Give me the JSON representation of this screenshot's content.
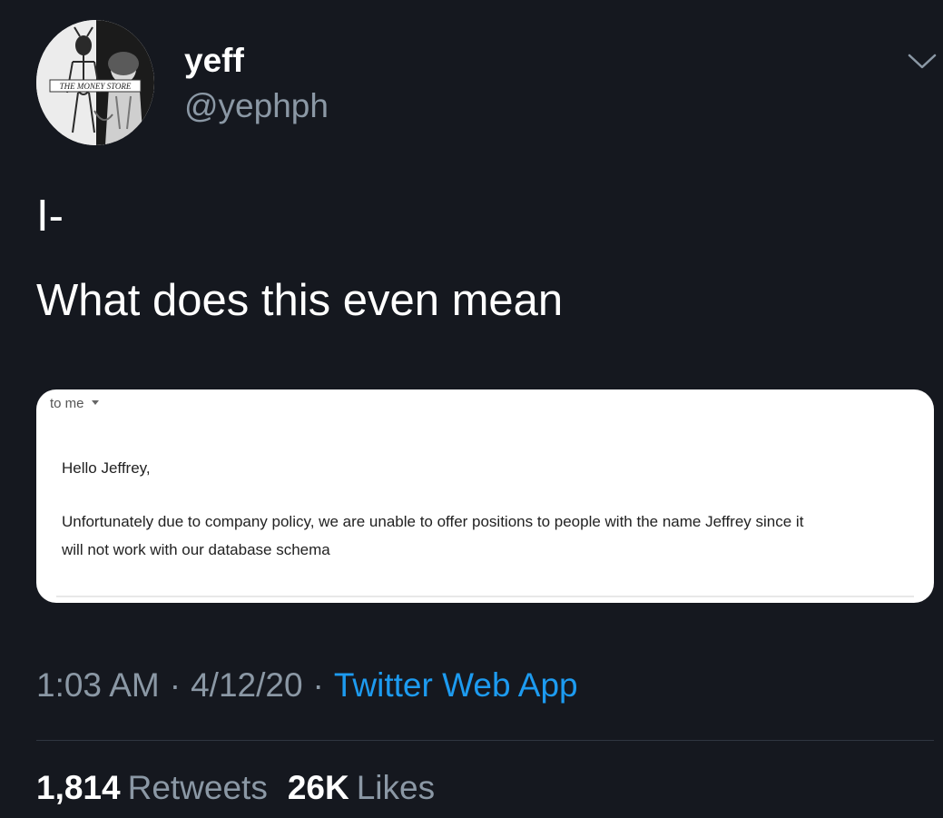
{
  "profile": {
    "display_name": "yeff",
    "handle": "@yephph",
    "avatar_caption": "THE MONEY STORE"
  },
  "tweet": {
    "lines": [
      "I-",
      "What does this even mean"
    ]
  },
  "email": {
    "recipient": "to me",
    "greeting": "Hello Jeffrey,",
    "body_lines": [
      "Unfortunately due to company policy, we are unable to offer positions to people with the name Jeffrey since it",
      "will not work with our database schema"
    ]
  },
  "meta": {
    "time": "1:03 AM",
    "separator": "·",
    "date": "4/12/20",
    "source": "Twitter Web App"
  },
  "stats": {
    "retweets_count": "1,814",
    "retweets_label": "Retweets",
    "likes_count": "26K",
    "likes_label": "Likes"
  },
  "icons": {
    "menu": "chevron-down-icon",
    "recipient_caret": "caret-down-icon"
  },
  "colors": {
    "background": "#15181f",
    "primary_text": "#ffffff",
    "secondary_text": "#8b98a5",
    "link": "#1d9bf0",
    "card": "#ffffff"
  }
}
